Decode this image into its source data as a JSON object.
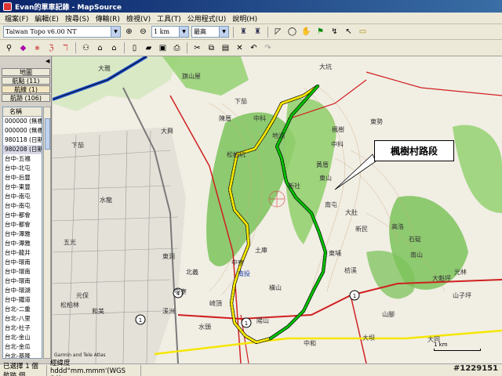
{
  "window": {
    "title": "Evan的單車記錄 - MapSource"
  },
  "menu": [
    "檔案(F)",
    "編輯(E)",
    "搜尋(S)",
    "傳輸(R)",
    "檢視(V)",
    "工具(T)",
    "公用程式(U)",
    "說明(H)"
  ],
  "toolbar": {
    "product": "Taiwan Topo v6.00 NT",
    "scale": "1 km",
    "detail": "最高"
  },
  "left_panel": {
    "tabs": [
      "地圖",
      "航點 (11)",
      "航線 (1)",
      "航跡 (106)"
    ],
    "active_tab": "航線 (1)",
    "list_header": "名稱",
    "rows": [
      "000000 (無標",
      "000000 (無標",
      "980118 (日期",
      "980208 (日期",
      "台中-五福",
      "台中-北屯",
      "台中-后豐",
      "台中-東豐",
      "台中-南屯",
      "台中-南屯",
      "台中-都會",
      "台中-都會",
      "台中-潭雅",
      "台中-潭雅",
      "台中-龍井",
      "台中-環南",
      "台中-環南",
      "台中-環南",
      "台中-環湖",
      "台中-鐵道",
      "台北-二重",
      "台北-八里",
      "台北-社子",
      "台北-金山",
      "台北-金瓜",
      "台北-基隆",
      "台北-基隆"
    ],
    "selected_row": 3
  },
  "map": {
    "callout": "楓樹村路段",
    "labels": {
      "daya": "大雅",
      "qishanwu": "旗山屋",
      "daxing": "大興",
      "chendongmu": "陳厝",
      "zhongke": "中科",
      "dakeng": "大坑",
      "xiazhuang": "下茄",
      "dongshi": "東勢",
      "zhongmu": "中科",
      "dihu": "地湖",
      "huangxi": "黃厝",
      "xiazhu": "下茄",
      "nanjiu": "南屯",
      "dadu": "大肚",
      "xinmin": "新民",
      "gaoluo": "高洛",
      "shidian": "石碇",
      "dongpu": "東埔",
      "fangxi": "枋溪",
      "nanshan": "南山",
      "guanglin": "光林",
      "dakuiping": "大魁坪",
      "shanziping": "山子坪",
      "shanjiao": "山腳",
      "tuanmu": "土庫",
      "zhongliao": "中寮",
      "hengshan": "橫山",
      "dongdong": "東洞",
      "beiyi": "北義",
      "zhongliao2": "中寮",
      "yuanbao": "元保",
      "wuguang": "五光",
      "shuilong": "水龍",
      "xinshe": "新社",
      "fengshu": "楓樹",
      "dongshan": "東山",
      "datong": "大同",
      "daba": "大坝",
      "zhonghe": "中和",
      "yangshan": "陽山",
      "shuitou": "水頭",
      "qiding": "崎頂",
      "xizhi": "溪洲",
      "hemei": "和美",
      "songbai": "松柏林",
      "songbaiken": "松柏坑",
      "nantou": "南投"
    },
    "scale_label": "1 km",
    "credit": "Garmin and Tele Atlas"
  },
  "status": {
    "selection": "已選擇 1 個航跡 個",
    "coord_format": "經緯度 hddd°mm.mmm'(WGS 84)"
  },
  "watermark": "#1229151",
  "colors": {
    "route_yellow": "#f5e600",
    "route_green": "#00c000",
    "highway_blue": "#1b4cc9",
    "forest": "#7cc35c",
    "road_red": "#d02020"
  }
}
